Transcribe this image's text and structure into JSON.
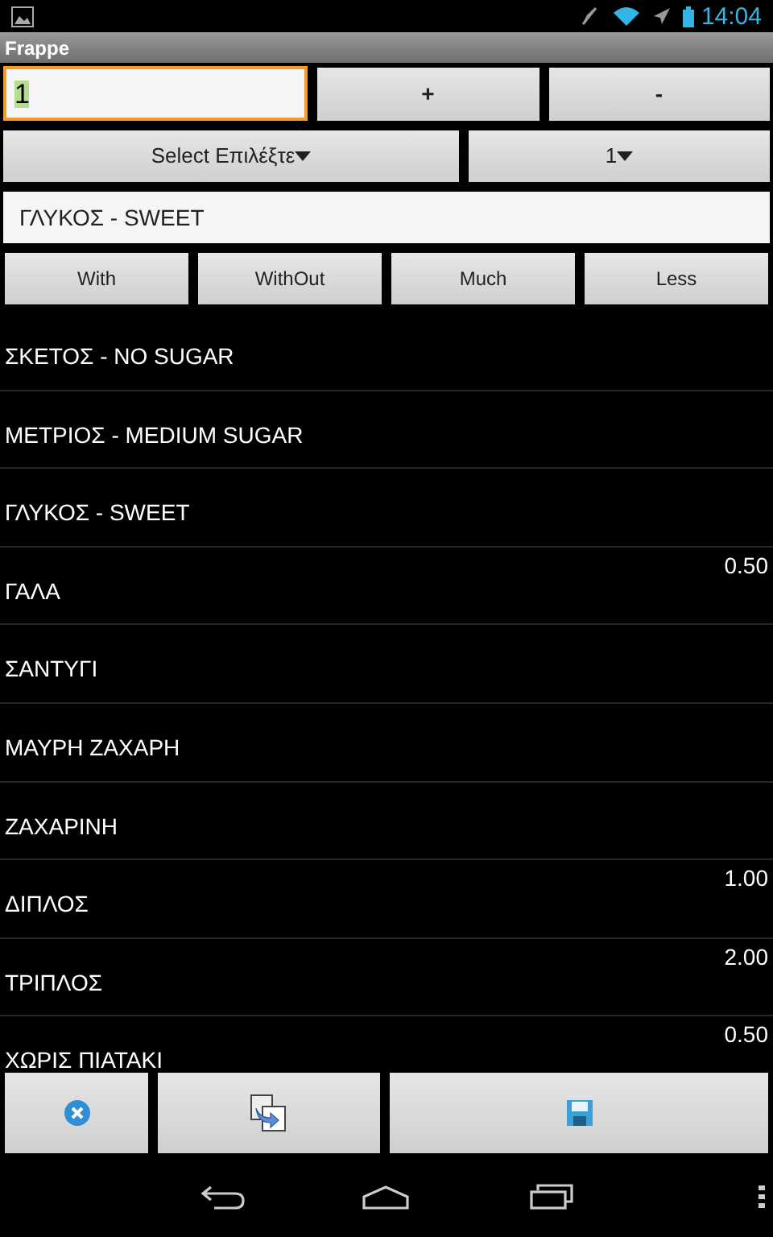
{
  "status_bar": {
    "time": "14:04"
  },
  "window": {
    "title": "Frappe"
  },
  "quantity": {
    "value": "1",
    "focused": true
  },
  "stepper": [
    "+",
    "-"
  ],
  "selects": [
    {
      "value": "Select Επιλέξτε"
    },
    {
      "value": "1"
    }
  ],
  "selected_text": "ΓΛΥΚΟΣ - SWEET",
  "modifiers": [
    "With",
    "WithOut",
    "Much",
    "Less"
  ],
  "items": [
    {
      "name": "ΣΚΕΤΟΣ - NO SUGAR"
    },
    {
      "name": "ΜΕΤΡΙΟΣ - MEDIUM SUGAR"
    },
    {
      "name": "ΓΛΥΚΟΣ - SWEET"
    },
    {
      "name": "ΓΑΛΑ",
      "price": "0.50"
    },
    {
      "name": "ΣΑΝΤΥΓΙ"
    },
    {
      "name": "ΜΑΥΡΗ ΖΑΧΑΡΗ"
    },
    {
      "name": "ΖΑΧΑΡΙΝΗ"
    },
    {
      "name": "ΔΙΠΛΟΣ",
      "price": "1.00"
    },
    {
      "name": "ΤΡΙΠΛΟΣ",
      "price": "2.00"
    },
    {
      "name": "ΧΩΡΙΣ ΠΙΑΤΑΚΙ",
      "price": "0.50"
    }
  ],
  "actions": [
    {
      "kind": "cancel"
    },
    {
      "kind": "copy"
    },
    {
      "kind": "save"
    }
  ]
}
